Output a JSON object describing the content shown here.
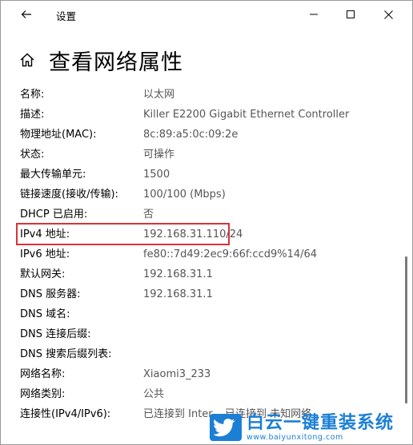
{
  "window": {
    "app_title": "设置"
  },
  "header": {
    "title": "查看网络属性"
  },
  "properties": [
    {
      "label": "名称:",
      "value": "以太网"
    },
    {
      "label": "描述:",
      "value": "Killer E2200 Gigabit Ethernet Controller"
    },
    {
      "label": "物理地址(MAC):",
      "value": "8c:89:a5:0c:09:2e"
    },
    {
      "label": "状态:",
      "value": "可操作"
    },
    {
      "label": "最大传输单元:",
      "value": "1500"
    },
    {
      "label": "链接速度(接收/传输):",
      "value": "100/100 (Mbps)"
    },
    {
      "label": "DHCP 已启用:",
      "value": "否"
    },
    {
      "label": "IPv4 地址:",
      "value": "192.168.31.110/24"
    },
    {
      "label": "IPv6 地址:",
      "value": "fe80::7d49:2ec9:66f:ccd9%14/64"
    },
    {
      "label": "默认网关:",
      "value": "192.168.31.1"
    },
    {
      "label": "DNS 服务器:",
      "value": "192.168.31.1"
    },
    {
      "label": "DNS 域名:",
      "value": ""
    },
    {
      "label": "DNS 连接后缀:",
      "value": ""
    },
    {
      "label": "DNS 搜索后缀列表:",
      "value": ""
    },
    {
      "label": "网络名称:",
      "value": "Xiaomi3_233"
    },
    {
      "label": "网络类别:",
      "value": "公共"
    },
    {
      "label": "连接性(IPv4/IPv6):",
      "value": "已连接到 Inter... 已连接到 未知网络"
    }
  ],
  "watermark": {
    "brand": "白云一键重装系统",
    "url": "www.baiyunxitong.com"
  },
  "colors": {
    "highlight": "#d9323b",
    "watermark": "#1b7fd6",
    "value_text": "#555555"
  }
}
